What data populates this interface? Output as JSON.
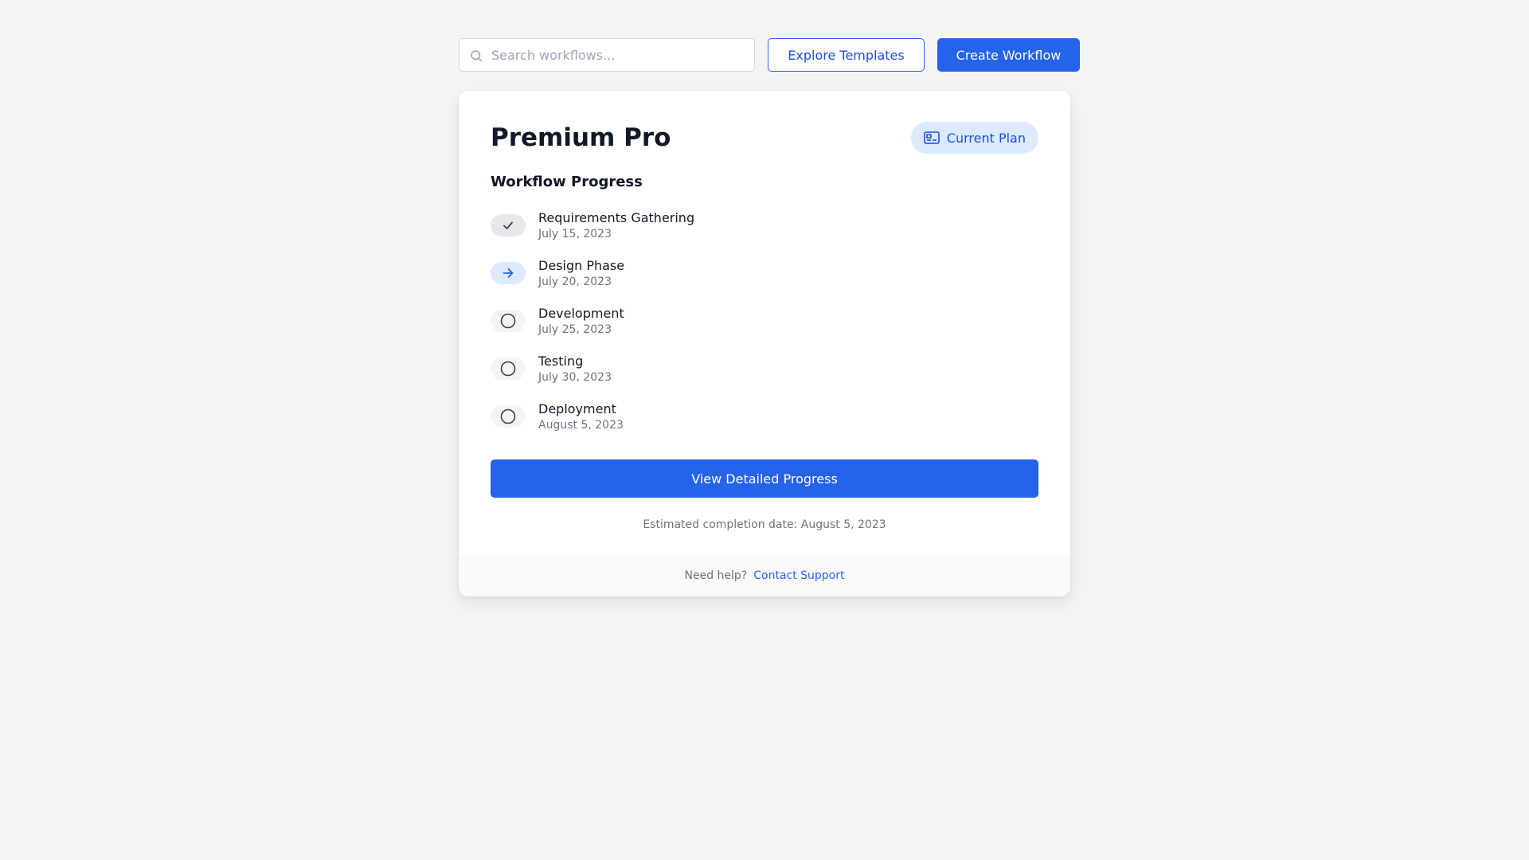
{
  "toolbar": {
    "search_placeholder": "Search workflows...",
    "search_value": "",
    "search_icon": "search-icon",
    "explore_label": "Explore Templates",
    "create_label": "Create Workflow"
  },
  "plan": {
    "title": "Premium Pro",
    "badge_label": "Current Plan",
    "badge_icon": "credit-card-icon"
  },
  "progress": {
    "title": "Workflow Progress",
    "steps": [
      {
        "name": "Requirements Gathering",
        "date": "July 15, 2023",
        "status": "completed",
        "icon": "check-icon"
      },
      {
        "name": "Design Phase",
        "date": "July 20, 2023",
        "status": "current",
        "icon": "arrow-right-icon"
      },
      {
        "name": "Development",
        "date": "July 25, 2023",
        "status": "pending",
        "icon": "circle-icon"
      },
      {
        "name": "Testing",
        "date": "July 30, 2023",
        "status": "pending",
        "icon": "circle-icon"
      },
      {
        "name": "Deployment",
        "date": "August 5, 2023",
        "status": "pending",
        "icon": "circle-icon"
      }
    ],
    "button_label": "View Detailed Progress",
    "completion_text": "Estimated completion date: August 5, 2023"
  },
  "footer": {
    "help_text": "Need help?",
    "support_link": "Contact Support"
  },
  "colors": {
    "accent": "#2563eb",
    "accent_light": "#dbeafe",
    "background": "#f3f4f6",
    "muted_text": "#6b7280"
  }
}
